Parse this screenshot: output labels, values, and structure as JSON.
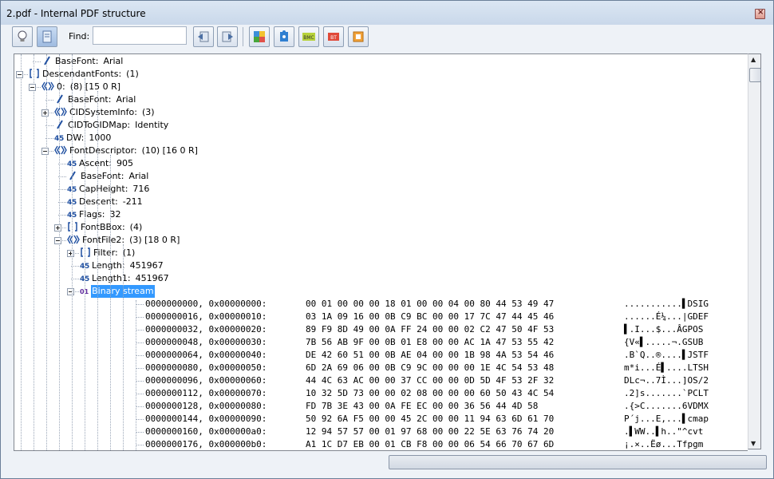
{
  "window": {
    "title": "2.pdf - Internal PDF structure"
  },
  "toolbar": {
    "find_label": "Find:",
    "find_value": "",
    "buttons": [
      {
        "name": "lightbulb-icon"
      },
      {
        "name": "document-icon"
      },
      {
        "name": "prev-page-icon"
      },
      {
        "name": "next-page-icon"
      },
      {
        "name": "puzzle-icon"
      },
      {
        "name": "pieces-icon"
      },
      {
        "name": "bmc-icon",
        "label": "BMC"
      },
      {
        "name": "bt-icon",
        "label": "BT"
      },
      {
        "name": "frame-icon"
      }
    ]
  },
  "tree": {
    "nodes": [
      {
        "level": 4,
        "type": "name",
        "key": "BaseFont:",
        "value": "Arial",
        "expander": "none"
      },
      {
        "level": 3,
        "type": "array",
        "key": "DescendantFonts:",
        "value": "(1)",
        "expander": "minus"
      },
      {
        "level": 4,
        "type": "dict",
        "key": "0:",
        "value": "(8) [15 0 R]",
        "expander": "minus"
      },
      {
        "level": 5,
        "type": "name",
        "key": "BaseFont:",
        "value": "Arial",
        "expander": "none"
      },
      {
        "level": 5,
        "type": "dict",
        "key": "CIDSystemInfo:",
        "value": "(3)",
        "expander": "plus"
      },
      {
        "level": 5,
        "type": "name",
        "key": "CIDToGIDMap:",
        "value": "Identity",
        "expander": "none"
      },
      {
        "level": 5,
        "type": "number",
        "key": "DW:",
        "value": "1000",
        "expander": "none"
      },
      {
        "level": 5,
        "type": "dict",
        "key": "FontDescriptor:",
        "value": "(10) [16 0 R]",
        "expander": "minus"
      },
      {
        "level": 6,
        "type": "number",
        "key": "Ascent:",
        "value": "905",
        "expander": "none"
      },
      {
        "level": 6,
        "type": "name",
        "key": "BaseFont:",
        "value": "Arial",
        "expander": "none"
      },
      {
        "level": 6,
        "type": "number",
        "key": "CapHeight:",
        "value": "716",
        "expander": "none"
      },
      {
        "level": 6,
        "type": "number",
        "key": "Descent:",
        "value": "-211",
        "expander": "none"
      },
      {
        "level": 6,
        "type": "number",
        "key": "Flags:",
        "value": "32",
        "expander": "none"
      },
      {
        "level": 6,
        "type": "array",
        "key": "FontBBox:",
        "value": "(4)",
        "expander": "plus"
      },
      {
        "level": 6,
        "type": "dict",
        "key": "FontFile2:",
        "value": "(3) [18 0 R]",
        "expander": "minus"
      },
      {
        "level": 7,
        "type": "array",
        "key": "Filter:",
        "value": "(1)",
        "expander": "plus"
      },
      {
        "level": 7,
        "type": "number",
        "key": "Length:",
        "value": "451967",
        "expander": "none"
      },
      {
        "level": 7,
        "type": "number",
        "key": "Length1:",
        "value": "451967",
        "expander": "none"
      },
      {
        "level": 7,
        "type": "binary",
        "key": "Binary stream",
        "value": "",
        "expander": "minus",
        "selected": true
      }
    ],
    "hex_rows": [
      {
        "offset": "0000000000, 0x00000000:",
        "bytes": "00 01 00 00 00 18 01 00 00 04 00 80 44 53 49 47",
        "ascii": "...........▌DSIG"
      },
      {
        "offset": "0000000016, 0x00000010:",
        "bytes": "03 1A 09 16 00 0B C9 BC 00 00 17 7C 47 44 45 46",
        "ascii": "......É¼...|GDEF"
      },
      {
        "offset": "0000000032, 0x00000020:",
        "bytes": "89 F9 8D 49 00 0A FF 24 00 00 02 C2 47 50 4F 53",
        "ascii": "▌.I...$...ÂGPOS"
      },
      {
        "offset": "0000000048, 0x00000030:",
        "bytes": "7B 56 AB 9F 00 0B 01 E8 00 00 AC 1A 47 53 55 42",
        "ascii": "{V«▌.....¬.GSUB"
      },
      {
        "offset": "0000000064, 0x00000040:",
        "bytes": "DE 42 60 51 00 0B AE 04 00 00 1B 98 4A 53 54 46",
        "ascii": ".B`Q..®....▌JSTF"
      },
      {
        "offset": "0000000080, 0x00000050:",
        "bytes": "6D 2A 69 06 00 0B C9 9C 00 00 00 1E 4C 54 53 48",
        "ascii": "m*i...É▌....LTSH"
      },
      {
        "offset": "0000000096, 0x00000060:",
        "bytes": "44 4C 63 AC 00 00 37 CC 00 00 0D 5D 4F 53 2F 32",
        "ascii": "DLc¬..7Ì...]OS/2"
      },
      {
        "offset": "0000000112, 0x00000070:",
        "bytes": "10 32 5D 73 00 00 02 08 00 00 00 60 50 43 4C 54",
        "ascii": ".2]s.......`PCLT"
      },
      {
        "offset": "0000000128, 0x00000080:",
        "bytes": "FD 7B 3E 43 00 0A FE EC 00 00 36 56 44 4D 58",
        "ascii": ".{>C.......6VDMX"
      },
      {
        "offset": "0000000144, 0x00000090:",
        "bytes": "50 92 6A F5 00 00 45 2C 00 00 11 94 63 6D 61 70",
        "ascii": "P´j...E,...▌cmap"
      },
      {
        "offset": "0000000160, 0x000000a0:",
        "bytes": "12 94 57 57 00 01 97 68 00 00 22 5E 63 76 74 20",
        "ascii": ".▌WW..▌h..\"^cvt "
      },
      {
        "offset": "0000000176, 0x000000b0:",
        "bytes": "A1 1C D7 EB 00 01 CB F8 00 00 06 54 66 70 67 6D",
        "ascii": "¡.×..Ëø...Tfpgm"
      }
    ]
  }
}
